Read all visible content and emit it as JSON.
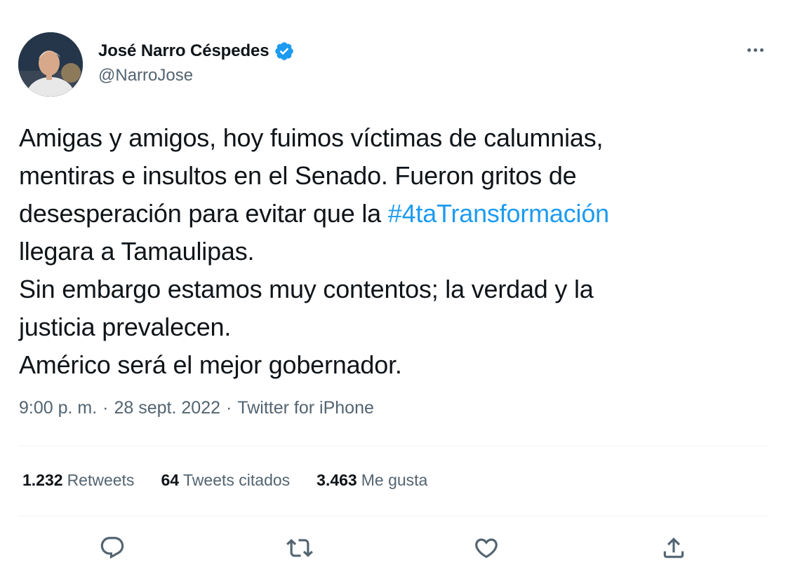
{
  "author": {
    "name": "José Narro Céspedes",
    "handle": "@NarroJose",
    "verified": true
  },
  "tweet": {
    "lines": [
      {
        "text": "Amigas y amigos, hoy fuimos víctimas de calumnias,"
      },
      {
        "text": "mentiras e insultos en el Senado. Fueron gritos de"
      },
      {
        "before": "desesperación para evitar que la ",
        "hashtag": "#4taTransformación"
      },
      {
        "text": "llegara a Tamaulipas."
      },
      {
        "text": "Sin embargo estamos muy contentos; la verdad y la"
      },
      {
        "text": "justicia prevalecen."
      },
      {
        "text": "Américo será el mejor gobernador."
      }
    ]
  },
  "meta": {
    "time": "9:00 p. m.",
    "separator": "·",
    "date": "28 sept. 2022",
    "source": "Twitter for iPhone"
  },
  "stats": {
    "retweets": {
      "count": "1.232",
      "label": "Retweets"
    },
    "quotes": {
      "count": "64",
      "label": "Tweets citados"
    },
    "likes": {
      "count": "3.463",
      "label": "Me gusta"
    }
  },
  "icons": {
    "reply": "reply-icon",
    "retweet": "retweet-icon",
    "like": "heart-icon",
    "share": "share-icon",
    "more": "more-icon",
    "verified": "verified-badge-icon"
  },
  "colors": {
    "text": "#0f1419",
    "secondary": "#536471",
    "accent": "#1d9bf0",
    "divider": "#eff3f4"
  }
}
